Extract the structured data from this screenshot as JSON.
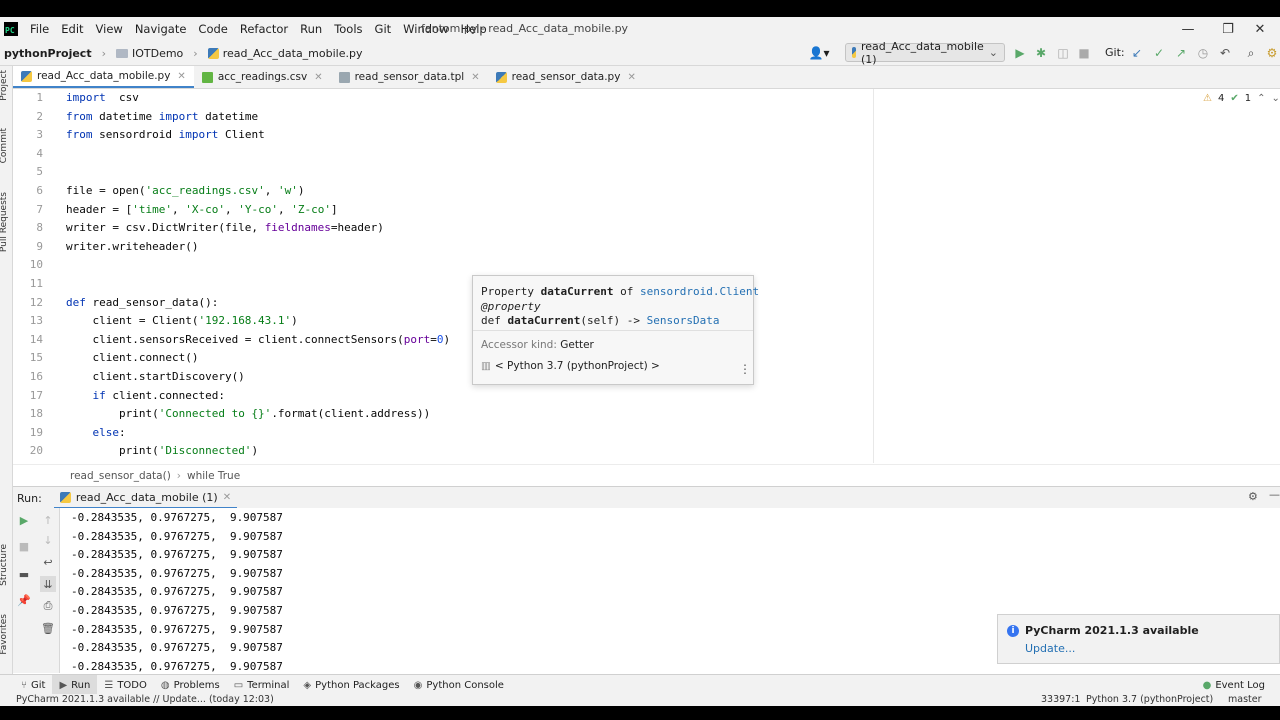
{
  "menu": {
    "items": [
      "File",
      "Edit",
      "View",
      "Navigate",
      "Code",
      "Refactor",
      "Run",
      "Tools",
      "Git",
      "Window",
      "Help"
    ],
    "window_title": "fantom.py - read_Acc_data_mobile.py"
  },
  "nav": {
    "project": "pythonProject",
    "folder": "IOTDemo",
    "file": "read_Acc_data_mobile.py",
    "run_config": "read_Acc_data_mobile (1)",
    "git_label": "Git:"
  },
  "left_strip": [
    "Project",
    "Commit",
    "Pull Requests",
    "Structure",
    "Favorites"
  ],
  "tabs": [
    {
      "label": "read_Acc_data_mobile.py"
    },
    {
      "label": "acc_readings.csv"
    },
    {
      "label": "read_sensor_data.tpl"
    },
    {
      "label": "read_sensor_data.py"
    }
  ],
  "editor": {
    "warnings": "4",
    "checks": "1",
    "line_numbers": [
      "1",
      "2",
      "3",
      "4",
      "5",
      "6",
      "7",
      "8",
      "9",
      "10",
      "11",
      "12",
      "13",
      "14",
      "15",
      "16",
      "17",
      "18",
      "19",
      "20"
    ],
    "lines": [
      {
        "p": [
          [
            "kw",
            "import"
          ],
          [
            "",
            "  csv"
          ]
        ]
      },
      {
        "p": [
          [
            "kw",
            "from"
          ],
          [
            "",
            " datetime "
          ],
          [
            "kw",
            "import"
          ],
          [
            "",
            " datetime"
          ]
        ]
      },
      {
        "p": [
          [
            "kw",
            "from"
          ],
          [
            "",
            " sensordroid "
          ],
          [
            "kw",
            "import"
          ],
          [
            "",
            " Client"
          ]
        ]
      },
      {
        "p": []
      },
      {
        "p": []
      },
      {
        "p": [
          [
            "",
            "file = open("
          ],
          [
            "str",
            "'acc_readings.csv'"
          ],
          [
            "",
            ", "
          ],
          [
            "str",
            "'w'"
          ],
          [
            "",
            ")"
          ]
        ]
      },
      {
        "p": [
          [
            "",
            "header = ["
          ],
          [
            "str",
            "'time'"
          ],
          [
            "",
            ", "
          ],
          [
            "str",
            "'X-co'"
          ],
          [
            "",
            ", "
          ],
          [
            "str",
            "'Y-co'"
          ],
          [
            "",
            ", "
          ],
          [
            "str",
            "'Z-co'"
          ],
          [
            "",
            "]"
          ]
        ]
      },
      {
        "p": [
          [
            "",
            "writer = csv.DictWriter(file, "
          ],
          [
            "param",
            "fieldnames"
          ],
          [
            "",
            "=header)"
          ]
        ]
      },
      {
        "p": [
          [
            "",
            "writer.writeheader()"
          ]
        ]
      },
      {
        "p": []
      },
      {
        "p": []
      },
      {
        "p": [
          [
            "kw",
            "def"
          ],
          [
            "",
            " read_sensor_data():"
          ]
        ]
      },
      {
        "p": [
          [
            "",
            "    client = Client("
          ],
          [
            "str",
            "'192.168.43.1'"
          ],
          [
            "",
            ")"
          ]
        ]
      },
      {
        "p": [
          [
            "",
            "    client.sensorsReceived = client.connectSensors("
          ],
          [
            "param",
            "port"
          ],
          [
            "",
            "="
          ],
          [
            "num",
            "0"
          ],
          [
            "",
            ")"
          ]
        ]
      },
      {
        "p": [
          [
            "",
            "    client.connect()"
          ]
        ]
      },
      {
        "p": [
          [
            "",
            "    client.startDiscovery()"
          ]
        ]
      },
      {
        "p": [
          [
            "",
            "    "
          ],
          [
            "kw",
            "if"
          ],
          [
            "",
            " client.connected:"
          ]
        ]
      },
      {
        "p": [
          [
            "",
            "        print("
          ],
          [
            "str",
            "'Connected to {}'"
          ],
          [
            "",
            ".format(client.address))"
          ]
        ]
      },
      {
        "p": [
          [
            "",
            "    "
          ],
          [
            "kw",
            "else"
          ],
          [
            "",
            ":"
          ]
        ]
      },
      {
        "p": [
          [
            "",
            "        print("
          ],
          [
            "str",
            "'Disconnected'"
          ],
          [
            "",
            ")"
          ]
        ]
      }
    ]
  },
  "popup": {
    "property_kw": "Property ",
    "property_name": "dataCurrent",
    "of_text": " of ",
    "class_link": "sensordroid.Client",
    "decorator": "@property",
    "def_kw": "def ",
    "def_name": "dataCurrent",
    "def_args": "(self) -> ",
    "return_type": "SensorsData",
    "accessor_label": "Accessor kind:",
    "accessor_value": "Getter",
    "interpreter": "< Python 3.7 (pythonProject) >"
  },
  "editor_breadcrumbs": [
    "read_sensor_data()",
    "while True"
  ],
  "run": {
    "label": "Run:",
    "tab": "read_Acc_data_mobile (1)",
    "output_lines": [
      "-0.2843535, 0.9767275,  9.907587",
      "-0.2843535, 0.9767275,  9.907587",
      "-0.2843535, 0.9767275,  9.907587",
      "-0.2843535, 0.9767275,  9.907587",
      "-0.2843535, 0.9767275,  9.907587",
      "-0.2843535, 0.9767275,  9.907587",
      "-0.2843535, 0.9767275,  9.907587",
      "-0.2843535, 0.9767275,  9.907587",
      "-0.2843535, 0.9767275,  9.907587"
    ]
  },
  "notification": {
    "title": "PyCharm 2021.1.3 available",
    "action": "Update..."
  },
  "tool_windows": [
    "Git",
    "Run",
    "TODO",
    "Problems",
    "Terminal",
    "Python Packages",
    "Python Console"
  ],
  "event_log": "Event Log",
  "status": {
    "message": "PyCharm 2021.1.3 available // Update... (today 12:03)",
    "position": "33397:1",
    "interpreter": "Python 3.7 (pythonProject)",
    "branch": "master"
  },
  "colors": {
    "accent": "#4083c9",
    "keyword": "#0033b3",
    "string": "#067d17",
    "run_green": "#59a869"
  }
}
